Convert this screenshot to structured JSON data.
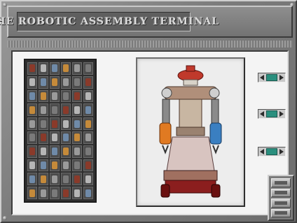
{
  "window": {
    "title": "THE ROBOTIC ASSEMBLY TERMINAL"
  },
  "parts_palette": {
    "columns": 6,
    "rows": 10,
    "part_colors": [
      "#8a3a2a",
      "#b6b6b6",
      "#6f8aa8",
      "#c58a3a",
      "#9a9a9a",
      "#7a7a7a"
    ]
  },
  "robot_preview": {
    "head_color": "#c0392b",
    "body_color": "#b08f7a",
    "left_arm_color": "#e07a22",
    "right_arm_color": "#3a7fc1",
    "base_color": "#8b1e1e"
  },
  "part_selectors": [
    {
      "name": "head"
    },
    {
      "name": "body"
    },
    {
      "name": "legs"
    }
  ],
  "side_buttons": [
    {
      "name": "button-1"
    },
    {
      "name": "button-2"
    },
    {
      "name": "button-3"
    },
    {
      "name": "button-4"
    }
  ],
  "colors": {
    "indicator": "#2a8f7e",
    "metal": "#7b7b7b"
  }
}
